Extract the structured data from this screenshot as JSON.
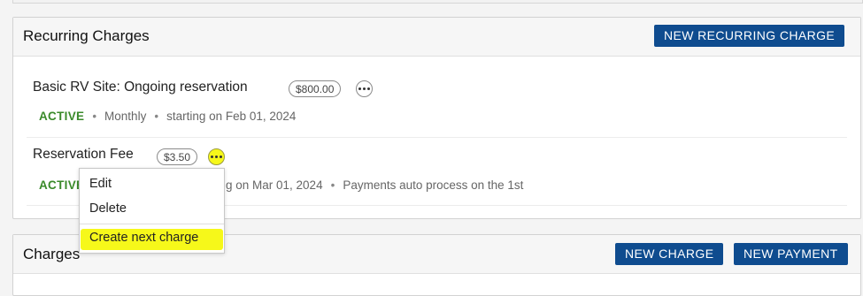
{
  "recurring": {
    "title": "Recurring Charges",
    "new_button": "NEW RECURRING CHARGE",
    "items": [
      {
        "name": "Basic RV Site: Ongoing reservation",
        "amount": "$800.00",
        "status": "ACTIVE",
        "frequency": "Monthly",
        "start": "starting on Feb 01, 2024"
      },
      {
        "name": "Reservation Fee",
        "amount": "$3.50",
        "status": "ACTIVE",
        "start": "g on Mar 01, 2024",
        "note": "Payments auto process on the 1st"
      }
    ]
  },
  "menu": {
    "edit": "Edit",
    "delete": "Delete",
    "create_next": "Create next charge"
  },
  "charges": {
    "title": "Charges",
    "new_charge": "NEW CHARGE",
    "new_payment": "NEW PAYMENT"
  },
  "colors": {
    "button_bg": "#0f4c8f",
    "active_green": "#3a8a2a",
    "highlight": "#f6f81a"
  }
}
